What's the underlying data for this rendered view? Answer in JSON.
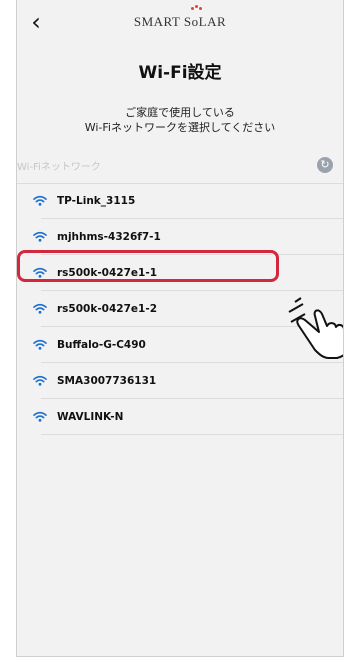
{
  "nav": {
    "back_glyph": "‹",
    "logo_text_1": "SMART S",
    "logo_text_2": "LAR",
    "logo_o": "o"
  },
  "page": {
    "title": "Wi-Fi設定",
    "desc_line1": "ご家庭で使用している",
    "desc_line2": "Wi-Fiネットワークを選択してください"
  },
  "section": {
    "label": "Wi-Fiネットワーク",
    "refresh_icon": "refresh-icon"
  },
  "networks": [
    {
      "name": "TP-Link_3115"
    },
    {
      "name": "mjhhms-4326f7-1"
    },
    {
      "name": "rs500k-0427e1-1"
    },
    {
      "name": "rs500k-0427e1-2"
    },
    {
      "name": "Buffalo-G-C490"
    },
    {
      "name": "SMA3007736131"
    },
    {
      "name": "WAVLINK-N"
    }
  ],
  "colors": {
    "highlight": "#d3273e",
    "logo_dot": "#e8442b",
    "refresh": "#9aa3ad"
  },
  "annotation": {
    "highlighted_index": 2,
    "pointer_icon": "tap-hand-icon"
  }
}
